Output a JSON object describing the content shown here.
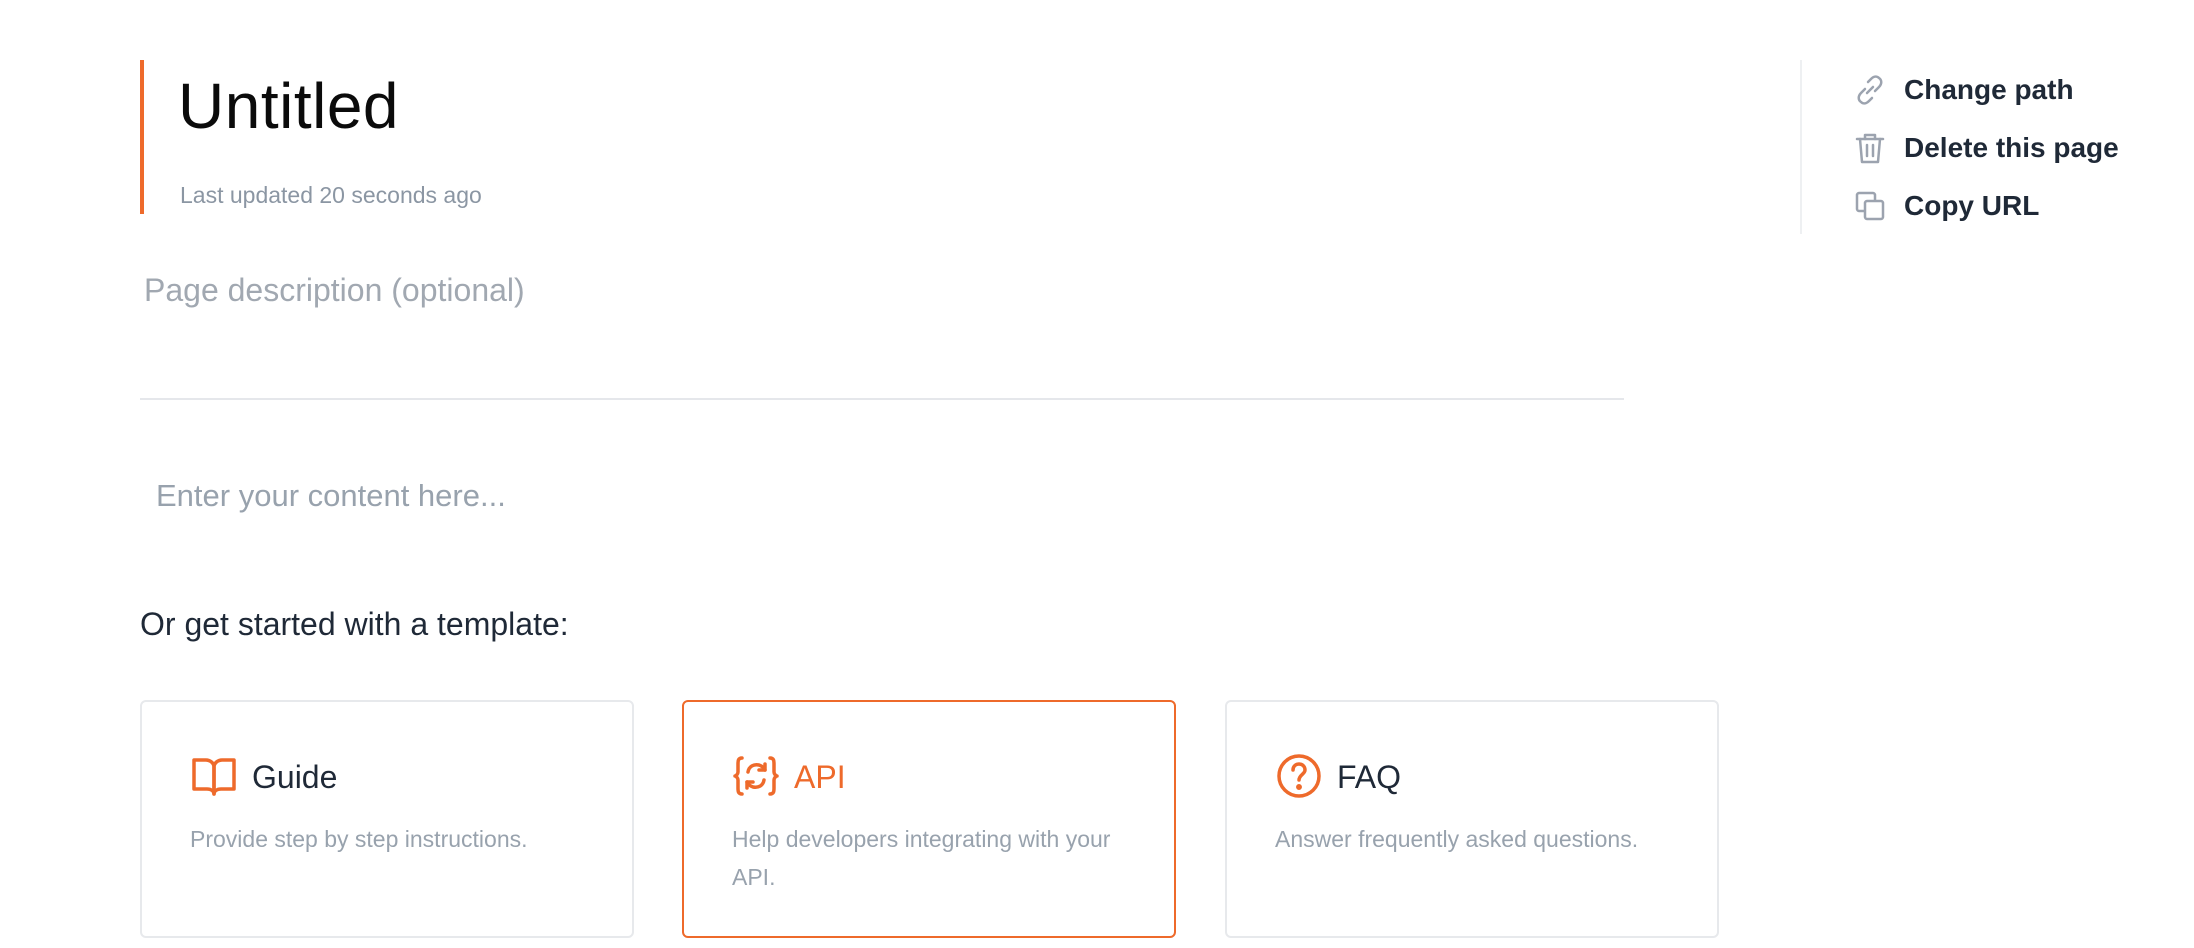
{
  "header": {
    "title": "Untitled",
    "last_updated": "Last updated 20 seconds ago"
  },
  "description": {
    "placeholder": "Page description (optional)",
    "value": ""
  },
  "editor": {
    "placeholder": "Enter your content here..."
  },
  "templates": {
    "heading": "Or get started with a template:",
    "items": [
      {
        "icon": "book-icon",
        "title": "Guide",
        "description": "Provide step by step instructions.",
        "selected": false
      },
      {
        "icon": "api-icon",
        "title": "API",
        "description": "Help developers integrating with your API.",
        "selected": true
      },
      {
        "icon": "question-circle-icon",
        "title": "FAQ",
        "description": "Answer frequently asked questions.",
        "selected": false
      }
    ]
  },
  "actions": [
    {
      "icon": "link-icon",
      "label": "Change path"
    },
    {
      "icon": "trash-icon",
      "label": "Delete this page"
    },
    {
      "icon": "copy-icon",
      "label": "Copy URL"
    }
  ],
  "colors": {
    "accent": "#ee6a2b",
    "muted_text": "#98a2ad",
    "border": "#e7e9ec"
  }
}
